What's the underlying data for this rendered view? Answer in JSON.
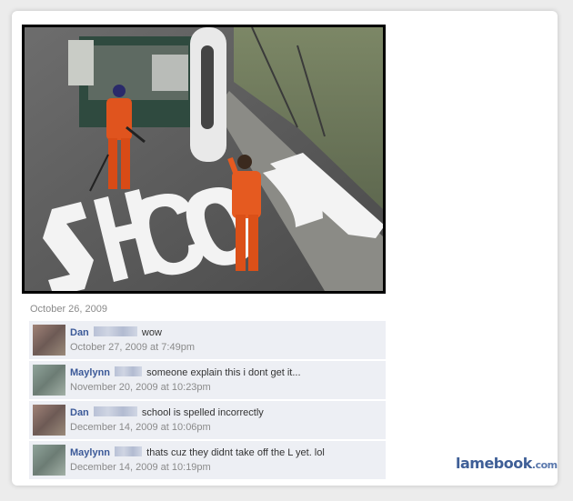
{
  "post": {
    "date": "October 26, 2009",
    "photo_text": "SHCOOL"
  },
  "comments": [
    {
      "name": "Dan",
      "text": "wow",
      "time": "October 27, 2009 at 7:49pm",
      "avatar_color": "#8a6f66"
    },
    {
      "name": "Maylynn",
      "text": "someone explain this i dont get it...",
      "time": "November 20, 2009 at 10:23pm",
      "avatar_color": "#7f8f86"
    },
    {
      "name": "Dan",
      "text": "school is spelled incorrectly",
      "time": "December 14, 2009 at 10:06pm",
      "avatar_color": "#8a6f66"
    },
    {
      "name": "Maylynn",
      "text": "thats cuz they didnt take off the L yet. lol",
      "time": "December 14, 2009 at 10:19pm",
      "avatar_color": "#7f8f86"
    }
  ],
  "watermark": {
    "brand": "lamebook",
    "suffix": ".com"
  }
}
